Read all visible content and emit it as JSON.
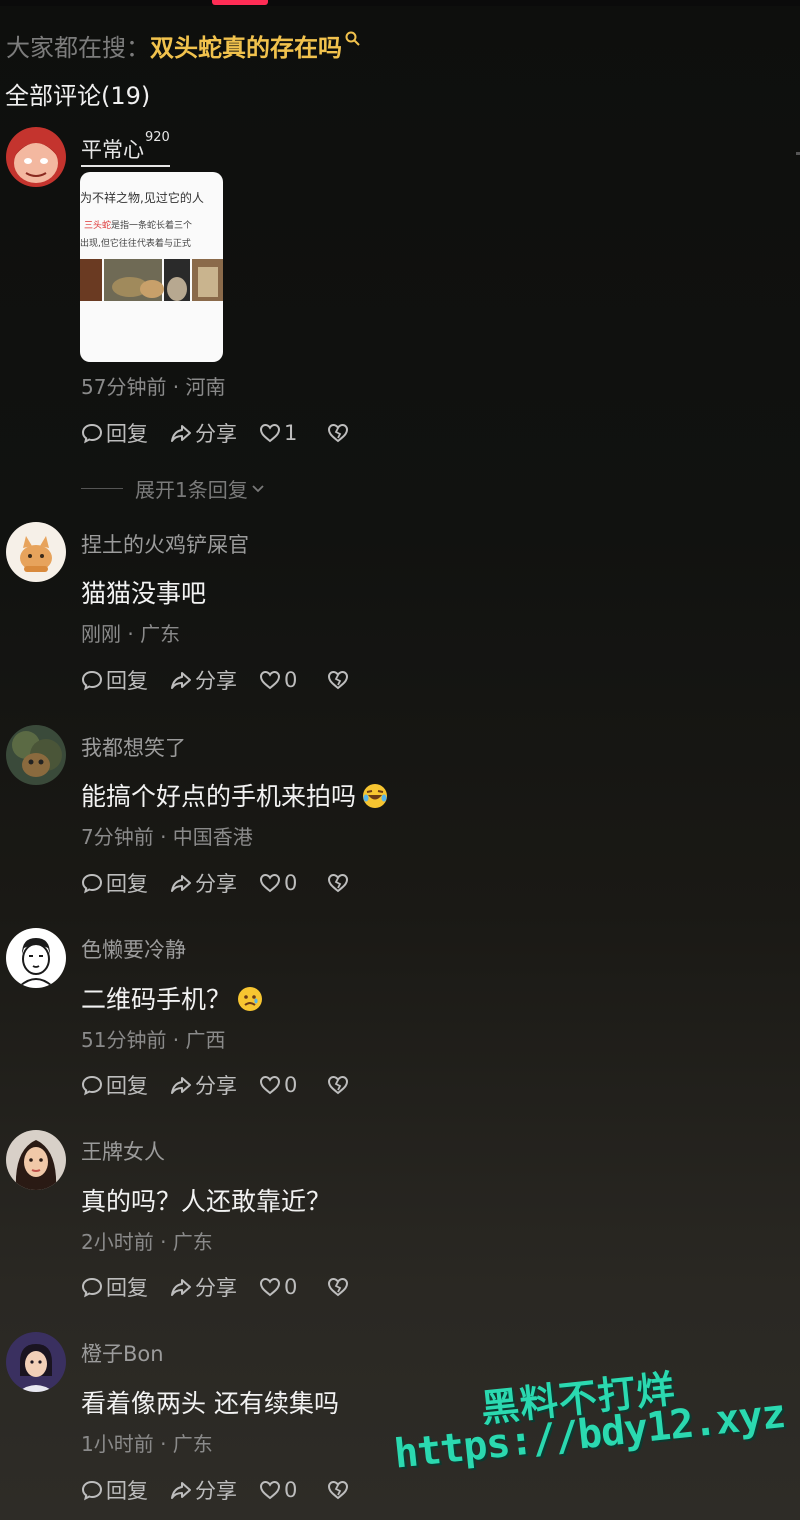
{
  "search": {
    "prefix": "大家都在搜：",
    "term": "双头蛇真的存在吗"
  },
  "header": {
    "title": "全部评论(19)"
  },
  "comments": [
    {
      "username": "平常心",
      "badge": "920",
      "image": {
        "line1": "为不祥之物,见过它的人",
        "line2_highlight": "三头蛇",
        "line2_rest": "是指一条蛇长着三个",
        "line3": "出现,但它往往代表着与正式"
      },
      "meta": "57分钟前 · 河南",
      "reply": "回复",
      "share": "分享",
      "likes": "1",
      "expand": "展开1条回复"
    },
    {
      "username": "捏土的火鸡铲屎官",
      "text": "猫猫没事吧",
      "meta": "刚刚 · 广东",
      "reply": "回复",
      "share": "分享",
      "likes": "0"
    },
    {
      "username": "我都想笑了",
      "text": "能搞个好点的手机来拍吗",
      "meta": "7分钟前 · 中国香港",
      "reply": "回复",
      "share": "分享",
      "likes": "0"
    },
    {
      "username": "色懒要冷静",
      "text": "二维码手机？",
      "meta": "51分钟前 · 广西",
      "reply": "回复",
      "share": "分享",
      "likes": "0"
    },
    {
      "username": "王牌女人",
      "text": "真的吗？人还敢靠近？",
      "meta": "2小时前 · 广东",
      "reply": "回复",
      "share": "分享",
      "likes": "0"
    },
    {
      "username": "橙子Bon",
      "text": "看着像两头 还有续集吗",
      "meta": "1小时前 · 广东",
      "reply": "回复",
      "share": "分享",
      "likes": "0"
    }
  ],
  "watermark": {
    "line1": "黑料不打烊",
    "line2": "https://bdy12.xyz"
  },
  "colors": {
    "accent": "#ff2d55",
    "search_term": "#f1c24d",
    "watermark": "#2bd9b0"
  }
}
